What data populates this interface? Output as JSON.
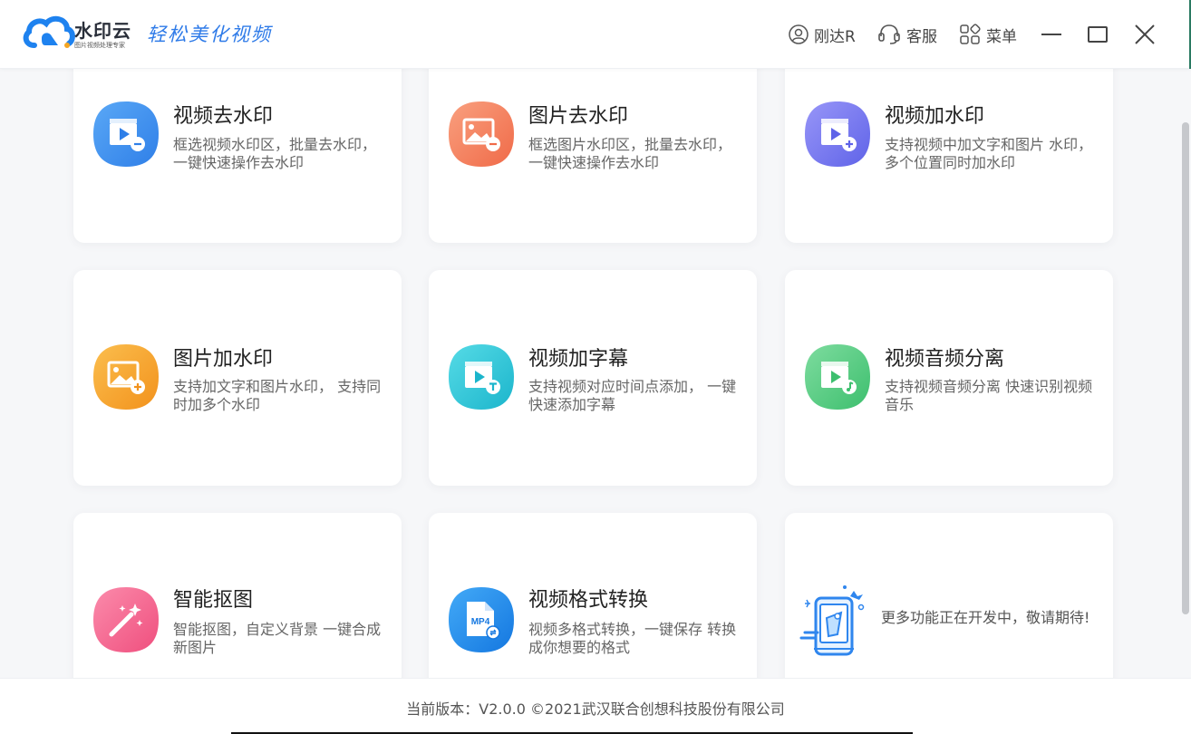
{
  "header": {
    "logo_text": "水印云",
    "logo_sub": "图片视频处理专家",
    "slogan": "轻松美化视频",
    "user_label": "刚达R",
    "service_label": "客服",
    "menu_label": "菜单"
  },
  "cards": [
    {
      "title": "视频去水印",
      "desc": "框选视频水印区，批量去水印， 一键快速操作去水印",
      "icon": "video-remove-watermark-icon",
      "color": "#3d8ef0"
    },
    {
      "title": "图片去水印",
      "desc": "框选图片水印区，批量去水印， 一键快速操作去水印",
      "icon": "image-remove-watermark-icon",
      "color": "#f4825f"
    },
    {
      "title": "视频加水印",
      "desc": "支持视频中加文字和图片 水印，多个位置同时加水印",
      "icon": "video-add-watermark-icon",
      "color": "#7b7cf2"
    },
    {
      "title": "图片加水印",
      "desc": "支持加文字和图片水印， 支持同时加多个水印",
      "icon": "image-add-watermark-icon",
      "color": "#f6a52e"
    },
    {
      "title": "视频加字幕",
      "desc": "支持视频对应时间点添加， 一键快速添加字幕",
      "icon": "video-subtitle-icon",
      "color": "#2fc8d8"
    },
    {
      "title": "视频音频分离",
      "desc": "支持视频音频分离 快速识别视频音乐",
      "icon": "audio-separate-icon",
      "color": "#4fcc83"
    },
    {
      "title": "智能抠图",
      "desc": "智能抠图，自定义背景 一键合成新图片",
      "icon": "magic-wand-icon",
      "color": "#f5658f"
    },
    {
      "title": "视频格式转换",
      "desc": "视频多格式转换，一键保存 转换成你想要的格式",
      "icon": "mp4-convert-icon",
      "color": "#1f8ff0",
      "badge": "MP4"
    }
  ],
  "more": {
    "text": "更多功能正在开发中，敬请期待!"
  },
  "footer": {
    "text": "当前版本：V2.0.0 ©2021武汉联合创想科技股份有限公司"
  }
}
